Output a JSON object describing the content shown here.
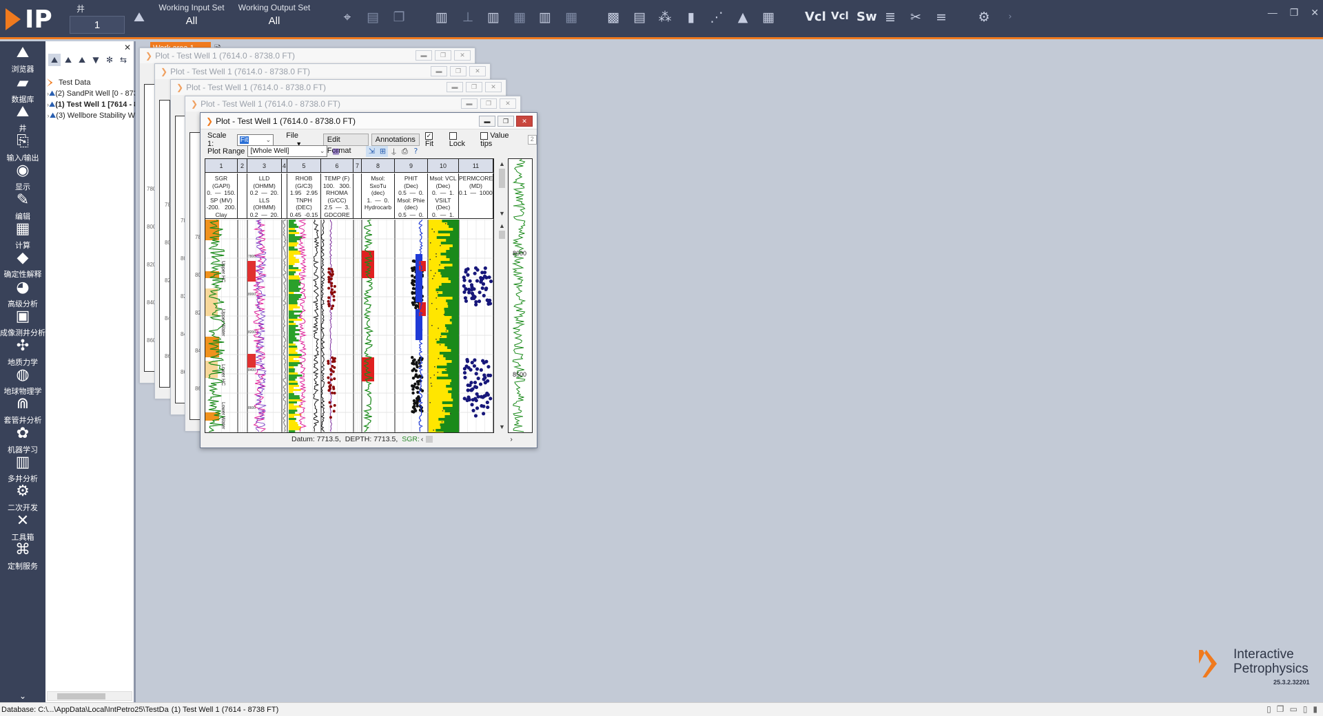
{
  "topbar": {
    "logo_text": "IP",
    "well_label": "井",
    "well_value": "1",
    "working_input_label": "Working Input Set",
    "working_input_value": "All",
    "working_output_label": "Working Output Set",
    "working_output_value": "All",
    "vcl_label": "Vcl",
    "vcl2_label": "Vcl",
    "sw_label": "Sw"
  },
  "leftnav": [
    {
      "label": "浏览器",
      "icon": "well-browser-icon"
    },
    {
      "label": "数据库",
      "icon": "folder-icon"
    },
    {
      "label": "井",
      "icon": "well-icon"
    },
    {
      "label": "输入/输出",
      "icon": "import-export-icon"
    },
    {
      "label": "显示",
      "icon": "eye-icon"
    },
    {
      "label": "编辑",
      "icon": "edit-icon"
    },
    {
      "label": "计算",
      "icon": "calculator-icon"
    },
    {
      "label": "确定性解释",
      "icon": "drop-icon"
    },
    {
      "label": "高级分析",
      "icon": "advanced-analysis-icon"
    },
    {
      "label": "成像测井分析",
      "icon": "image-log-icon"
    },
    {
      "label": "地质力学",
      "icon": "geomechanics-icon"
    },
    {
      "label": "地球物理学",
      "icon": "geophysics-icon"
    },
    {
      "label": "套管井分析",
      "icon": "cased-hole-icon"
    },
    {
      "label": "机器学习",
      "icon": "machine-learning-icon"
    },
    {
      "label": "多井分析",
      "icon": "multi-well-icon"
    },
    {
      "label": "二次开发",
      "icon": "gear-icon"
    },
    {
      "label": "工具箱",
      "icon": "tools-icon"
    },
    {
      "label": "定制服务",
      "icon": "custom-service-icon"
    }
  ],
  "tree": {
    "root": "Test Data",
    "items": [
      {
        "label": "(2) SandPit Well [0 - 873",
        "bold": false
      },
      {
        "label": "(1) Test Well 1 [7614 - 8",
        "bold": true
      },
      {
        "label": "(3) Wellbore Stability W",
        "bold": false
      }
    ]
  },
  "workarea": {
    "tab_label": "Work area 1"
  },
  "bg_windows": [
    {
      "title": "Plot - Test Well 1 (7614.0 - 8738.0 FT)"
    },
    {
      "title": "Plot - Test Well 1 (7614.0 - 8738.0 FT)"
    },
    {
      "title": "Plot - Test Well 1 (7614.0 - 8738.0 FT)"
    },
    {
      "title": "Plot - Test Well 1 (7614.0 - 8738.0 FT)"
    }
  ],
  "bg_window_depths": [
    "780",
    "800",
    "820",
    "840",
    "860"
  ],
  "plot": {
    "title": "Plot - Test Well 1 (7614.0 - 8738.0 FT)",
    "scale_label": "Scale 1:",
    "scale_value": "Fit",
    "file_label": "File",
    "edit_format": "Edit Format",
    "annotations": "Annotations",
    "fit_label": "Fit",
    "lock_label": "Lock",
    "value_tips_label": "Value tips",
    "value_tips_num": "2",
    "range_label": "Plot Range",
    "range_value": "[Whole Well]",
    "track_numbers": [
      "1",
      "2",
      "3",
      "4",
      "5",
      "6",
      "7",
      "8",
      "9",
      "10",
      "11"
    ],
    "track_headers": [
      "SGR\n(GAPI)\n0.  —  150.\nSP (MV)\n-200.   200.\nClay",
      "",
      "LLD\n(OHMM)\n0.2  —  20.\nLLS\n(OHMM)\n0.2  —  20.",
      "",
      "RHOB\n(G/C3)\n1.95   2.95\nTNPH\n(DEC)\n0.45  -0.15",
      "TEMP (F)\n100.   300.\nRHOMA\n(G/CC)\n2.5  —  3.\nGDCORE",
      "",
      "Msol:\nSxoTu\n(dec)\n1.  —  0.\nHydrocarb",
      "PHIT\n(Dec)\n0.5  —  0.\nMsol: Phie\n(dec)\n0.5  —  0.",
      "Msol: VCL\n(Dec)\n0.  —  1.\nVSILT\n(Dec)\n0.  —  1.",
      "PERMCORE\n(MD)\n0.1  —  10000"
    ],
    "depth_labels": [
      "7800",
      "8000",
      "8200",
      "8400",
      "8600"
    ],
    "zone_labels": [
      "Upper HC",
      "Upper Water",
      "Lower HC",
      "Lower Water"
    ],
    "overview_depths": [
      "8000",
      "8500"
    ],
    "status_datum": "Datum: 7713.5,",
    "status_depth": "DEPTH: 7713.5,",
    "status_sgr": "SGR:"
  },
  "statusbar": {
    "database": "Database: C:\\...\\AppData\\Local\\IntPetro25\\TestDa",
    "well": "(1) Test Well 1 (7614 - 8738 FT)"
  },
  "brand": {
    "line1": "Interactive",
    "line2": "Petrophysics",
    "version": "25.3.2.32201"
  },
  "colors": {
    "accent": "#f07a1e",
    "topbar": "#394259",
    "workarea": "#c3cad6"
  }
}
